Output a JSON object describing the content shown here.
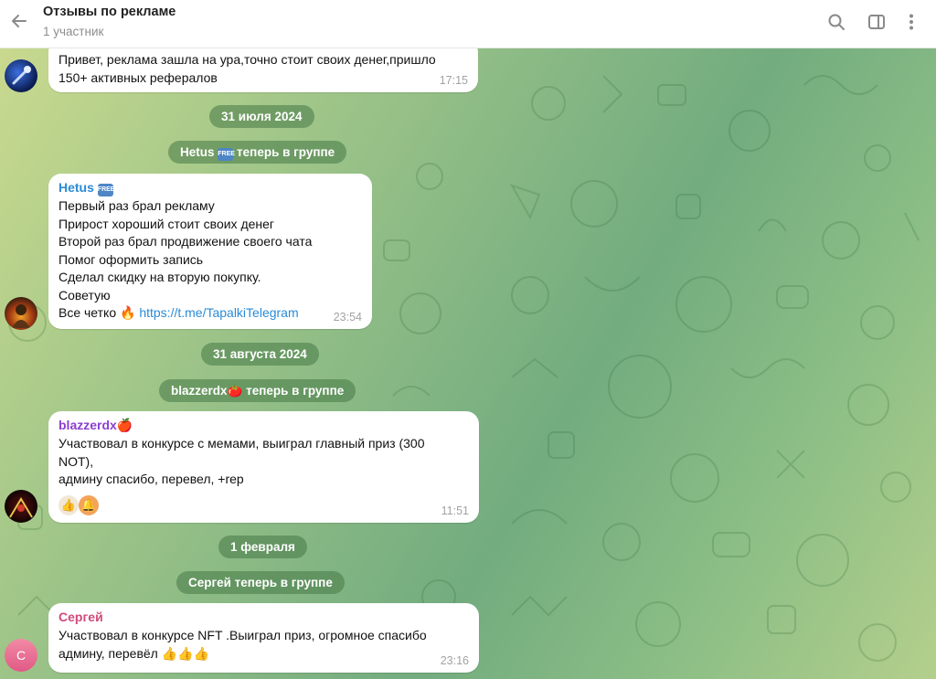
{
  "header": {
    "title": "Отзывы по рекламе",
    "subtitle": "1 участник"
  },
  "messages": [
    {
      "lines": [
        "Привет, реклама зашла на ура,точно стоит своих денег,пришло",
        "150+ активных рефералов"
      ],
      "time": "17:15"
    },
    {
      "sender": "Hetus",
      "sender_color": "#2a8bd6",
      "badge": "FREE",
      "lines": [
        "Первый раз брал рекламу",
        "Прирост хороший стоит своих денег",
        "Второй раз брал продвижение своего чата",
        "Помог оформить запись",
        "Сделал скидку на вторую покупку.",
        "Советую"
      ],
      "last_line_text": "Все четко",
      "last_line_emoji": "🔥",
      "link": "https://t.me/TapalkiTelegram",
      "time": "23:54"
    },
    {
      "sender": "blazzerdx",
      "sender_emoji": "🍎",
      "sender_color": "#8a3fd1",
      "lines": [
        "Участвовал в конкурсе с мемами, выиграл главный приз (300",
        "NOT),",
        "админу спасибо, перевел, +rep"
      ],
      "reactions": [
        "👍",
        "🔔"
      ],
      "time": "11:51"
    },
    {
      "sender": "Сергей",
      "sender_color": "#d04a7a",
      "avatar_letter": "С",
      "lines": [
        "Участвовал в конкурсе NFT .Выиграл приз, огромное спасибо",
        "админу, перевёл 👍👍👍"
      ],
      "time": "23:16"
    }
  ],
  "service": {
    "date1": "31 июля 2024",
    "join1_name": "Hetus",
    "join1_badge": "FREE",
    "join1_text": "теперь в группе",
    "date2": "31 августа 2024",
    "join2_name": "blazzerdx",
    "join2_emoji": "🍅",
    "join2_text": "теперь в группе",
    "date3": "1 февраля",
    "join3": "Сергей теперь в группе"
  },
  "icons": {
    "back": "arrow-left-icon",
    "search": "search-icon",
    "sidebar": "sidebar-toggle-icon",
    "more": "more-vertical-icon"
  },
  "colors": {
    "link": "#2a8bd6",
    "pill_bg": "rgba(70,120,70,0.55)"
  }
}
